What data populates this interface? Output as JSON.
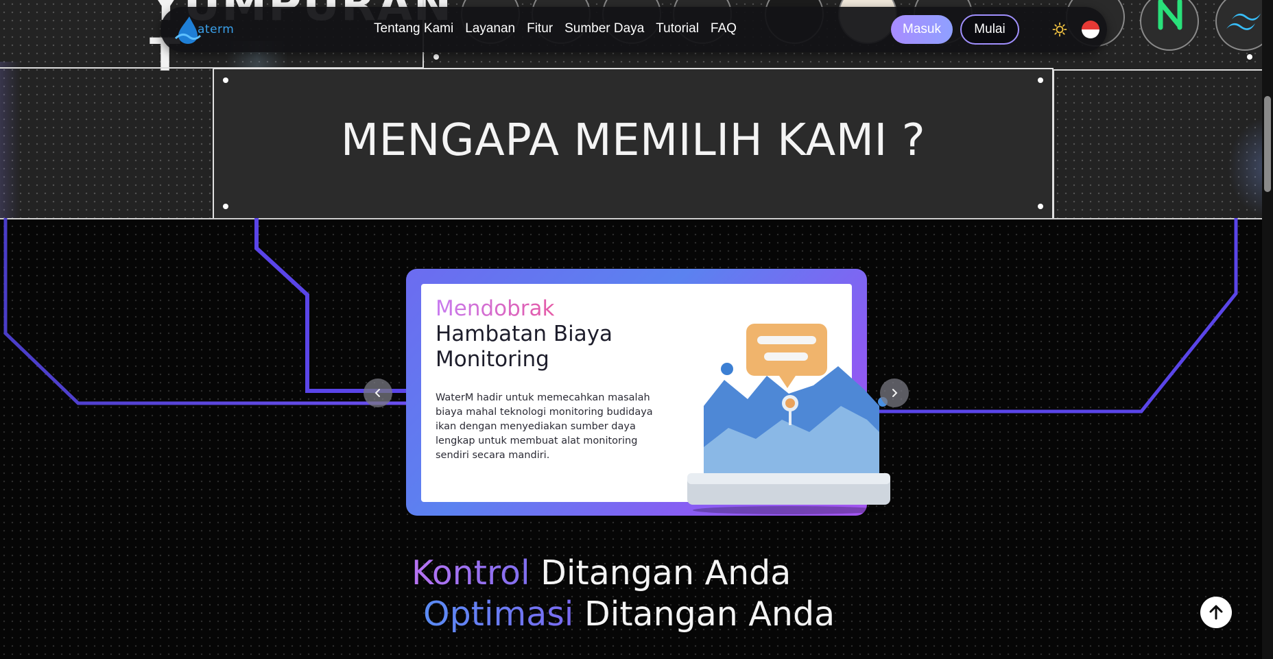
{
  "header": {
    "brand_text": "aterm",
    "ghost_heading": "YUMPURAN\nT",
    "nav_links": [
      "Tentang Kami",
      "Layanan",
      "Fitur",
      "Sumber Daya",
      "Tutorial",
      "FAQ"
    ],
    "login_label": "Masuk",
    "start_label": "Mulai",
    "theme_icon": "sun-icon",
    "language_icon": "indonesia-flag-icon"
  },
  "section": {
    "title": "MENGAPA MEMILIH KAMI ?"
  },
  "carousel": {
    "slide": {
      "heading_accent": "Mendobrak",
      "heading_rest": " Hambatan Biaya Monitoring",
      "description": "WaterM hadir untuk memecahkan masalah biaya mahal teknologi monitoring budidaya ikan dengan menyediakan sumber daya lengkap untuk membuat alat monitoring sendiri secara mandiri.",
      "illustration_icon": "analytics-chart-illustration"
    },
    "prev_icon": "chevron-left-icon",
    "next_icon": "chevron-right-icon"
  },
  "taglines": [
    {
      "accent": "Kontrol",
      "rest": " Ditangan Anda"
    },
    {
      "accent": "Optimasi",
      "rest": " Ditangan Anda"
    }
  ],
  "scroll_top_icon": "arrow-up-icon",
  "colors": {
    "accent_purple": "#a88cff",
    "accent_blue": "#5a8cf5",
    "circuit_line": "#5a45e8",
    "panel_bg": "#2b2b2b"
  }
}
